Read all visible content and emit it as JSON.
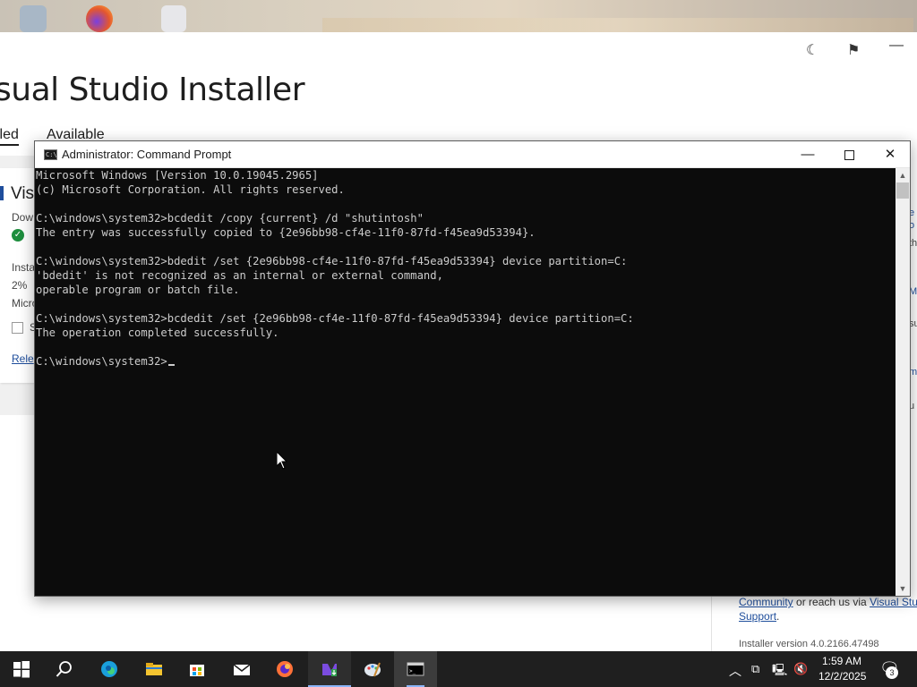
{
  "desktop": {
    "icons": [
      "recycle-bin-icon",
      "firefox-icon",
      "document-icon"
    ]
  },
  "vs_installer": {
    "title": "sual Studio Installer",
    "tabs": [
      {
        "label": "lled"
      },
      {
        "label": "Available"
      }
    ],
    "card": {
      "product_fragment": "Vis",
      "download_label": "Dow",
      "install_label": "Insta",
      "progress_text": "2%",
      "publisher_fragment": "Micro",
      "checkbox_fragment": "S",
      "release_link": "Rele"
    },
    "right_panel": {
      "community_link": "Community",
      "reach_text": " or reach us via ",
      "vs_link": "Visual Studi",
      "support_link": "Support",
      "support_suffix": ".",
      "version": "Installer version 4.0.2166.47498"
    }
  },
  "cmd_window": {
    "title": "Administrator: Command Prompt",
    "minimize_glyph": "—",
    "close_glyph": "✕",
    "lines": [
      "Microsoft Windows [Version 10.0.19045.2965]",
      "(c) Microsoft Corporation. All rights reserved.",
      "",
      "C:\\windows\\system32>bcdedit /copy {current} /d \"shutintosh\"",
      "The entry was successfully copied to {2e96bb98-cf4e-11f0-87fd-f45ea9d53394}.",
      "",
      "C:\\windows\\system32>bdedit /set {2e96bb98-cf4e-11f0-87fd-f45ea9d53394} device partition=C:",
      "'bdedit' is not recognized as an internal or external command,",
      "operable program or batch file.",
      "",
      "C:\\windows\\system32>bcdedit /set {2e96bb98-cf4e-11f0-87fd-f45ea9d53394} device partition=C:",
      "The operation completed successfully.",
      ""
    ],
    "prompt": "C:\\windows\\system32>"
  },
  "taskbar": {
    "items": [
      {
        "name": "start-button",
        "icon": "windows-logo-icon"
      },
      {
        "name": "search-button",
        "icon": "search-icon"
      },
      {
        "name": "edge-button",
        "icon": "edge-icon"
      },
      {
        "name": "file-explorer-button",
        "icon": "folder-icon"
      },
      {
        "name": "store-button",
        "icon": "store-icon"
      },
      {
        "name": "mail-button",
        "icon": "mail-icon"
      },
      {
        "name": "firefox-button",
        "icon": "firefox-icon"
      },
      {
        "name": "visual-studio-installer-button",
        "icon": "visual-studio-icon"
      },
      {
        "name": "paint-button",
        "icon": "paint-icon"
      },
      {
        "name": "command-prompt-button",
        "icon": "cmd-icon"
      }
    ],
    "tray": {
      "time": "1:59 AM",
      "date": "12/2/2025",
      "notification_count": "3",
      "colors": {
        "taskbar": "#1f1f1f",
        "accent": "#8ab4f8"
      }
    }
  }
}
